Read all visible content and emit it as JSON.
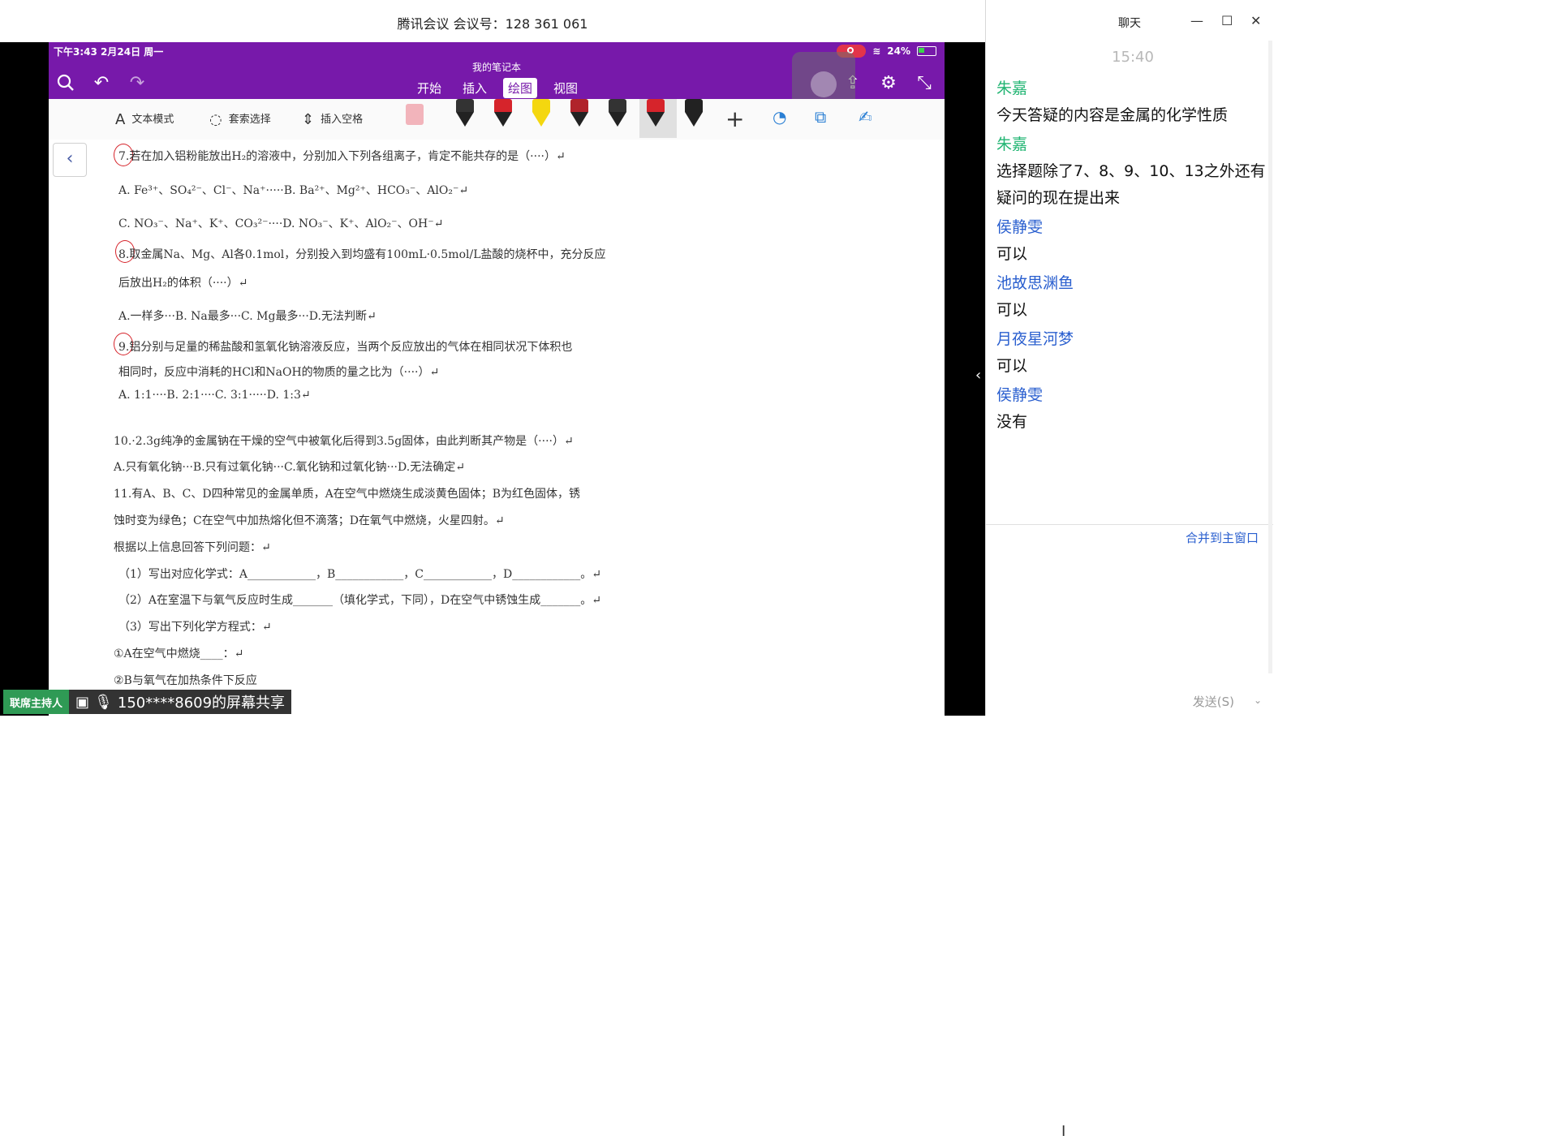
{
  "window": {
    "title": "腾讯会议 会议号：128 361 061"
  },
  "ipad": {
    "status_time": "下午3:43  2月24日 周一",
    "battery": "24%",
    "notebook_name": "我的笔记本",
    "tabs": [
      {
        "label": "开始"
      },
      {
        "label": "插入"
      },
      {
        "label": "绘图",
        "active": true
      },
      {
        "label": "视图"
      }
    ],
    "toolbar": {
      "text_mode": "文本模式",
      "lasso": "套索选择",
      "insert_space": "插入空格"
    },
    "pens": [
      {
        "cap": "#333333",
        "tip": "#222222"
      },
      {
        "cap": "#d6242b",
        "tip": "#222222"
      },
      {
        "cap": "#f4d70f",
        "tip": "#f4d70f"
      },
      {
        "cap": "#b0232b",
        "tip": "#222222"
      },
      {
        "cap": "#333333",
        "tip": "#222222"
      },
      {
        "cap": "#d6242b",
        "tip": "#222222"
      },
      {
        "cap": "#222222",
        "tip": "#222222"
      }
    ]
  },
  "document": {
    "lines": [
      "7.若在加入铝粉能放出H₂的溶液中，分别加入下列各组离子，肯定不能共存的是（····）↵",
      "A. Fe³⁺、SO₄²⁻、Cl⁻、Na⁺·····B. Ba²⁺、Mg²⁺、HCO₃⁻、AlO₂⁻↵",
      "C. NO₃⁻、Na⁺、K⁺、CO₃²⁻····D. NO₃⁻、K⁺、AlO₂⁻、OH⁻↵",
      "8.取金属Na、Mg、Al各0.1mol，分别投入到均盛有100mL·0.5mol/L盐酸的烧杯中，充分反应",
      "后放出H₂的体积（····）↵",
      "A.一样多···B. Na最多···C. Mg最多···D.无法判断↵",
      "9.铝分别与足量的稀盐酸和氢氧化钠溶液反应，当两个反应放出的气体在相同状况下体积也",
      "相同时，反应中消耗的HCl和NaOH的物质的量之比为（····）↵",
      "A. 1:1····B. 2:1····C. 3:1·····D. 1:3↵",
      "10.·2.3g纯净的金属钠在干燥的空气中被氧化后得到3.5g固体，由此判断其产物是（····）↵",
      "A.只有氧化钠···B.只有过氧化钠···C.氧化钠和过氧化钠···D.无法确定↵",
      "11.有A、B、C、D四种常见的金属单质，A在空气中燃烧生成淡黄色固体；B为红色固体，锈",
      "蚀时变为绿色；C在空气中加热熔化但不滴落；D在氧气中燃烧，火星四射。↵",
      "根据以上信息回答下列问题：↵",
      "（1）写出对应化学式：A____________，B____________，C____________，D____________。↵",
      "（2）A在室温下与氧气反应时生成_______（填化学式，下同），D在空气中锈蚀生成_______。↵",
      "（3）写出下列化学方程式：↵",
      "①A在空气中燃烧____：↵",
      "②B与氧气在加热条件下反应"
    ]
  },
  "banner": {
    "host": "联席主持人",
    "share_text": "150****8609的屏幕共享"
  },
  "chat": {
    "title": "聊天",
    "time": "15:40",
    "messages": [
      {
        "sender": "朱嘉",
        "color": "green",
        "text": "今天答疑的内容是金属的化学性质"
      },
      {
        "sender": "朱嘉",
        "color": "green",
        "text": "选择题除了7、8、9、10、13之外还有疑问的现在提出来"
      },
      {
        "sender": "侯静雯",
        "color": "blue",
        "text": "可以"
      },
      {
        "sender": "池故思渊鱼",
        "color": "blue",
        "text": "可以"
      },
      {
        "sender": "月夜星河梦",
        "color": "blue",
        "text": "可以"
      },
      {
        "sender": "侯静雯",
        "color": "blue",
        "text": "没有"
      }
    ],
    "merge_label": "合并到主窗口",
    "send_label": "发送(S)"
  }
}
